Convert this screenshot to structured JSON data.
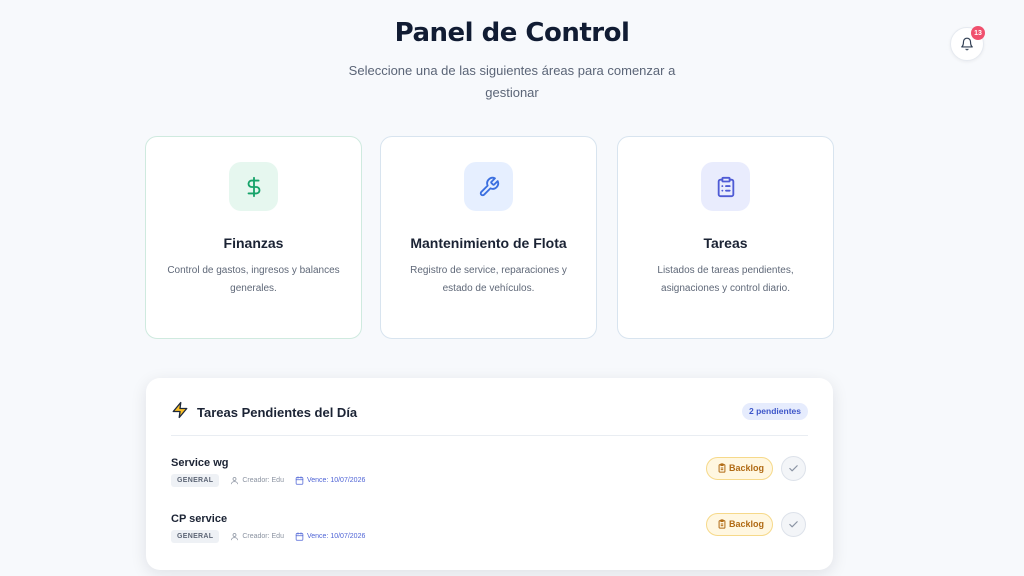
{
  "header": {
    "title": "Panel de Control",
    "subtitle": "Seleccione una de las siguientes áreas para comenzar a gestionar"
  },
  "notifications": {
    "icon": "bell-icon",
    "count": "13"
  },
  "cards": [
    {
      "icon": "dollar-icon",
      "title": "Finanzas",
      "description": "Control de gastos, ingresos y balances generales."
    },
    {
      "icon": "wrench-icon",
      "title": "Mantenimiento de Flota",
      "description": "Registro de service, reparaciones y estado de vehículos."
    },
    {
      "icon": "clipboard-icon",
      "title": "Tareas",
      "description": "Listados de tareas pendientes, asignaciones y control diario."
    }
  ],
  "pending_panel": {
    "icon": "bolt-icon",
    "title": "Tareas Pendientes del Día",
    "badge": "2 pendientes",
    "tasks": [
      {
        "name": "Service wg",
        "category": "GENERAL",
        "creator": "Creador: Edu",
        "due": "Vence: 10/07/2026",
        "status": "Backlog"
      },
      {
        "name": "CP service",
        "category": "GENERAL",
        "creator": "Creador: Edu",
        "due": "Vence: 10/07/2026",
        "status": "Backlog"
      }
    ]
  },
  "colors": {
    "accent_green": "#16a36a",
    "accent_blue": "#3b6fe0",
    "accent_indigo": "#4f5bd5",
    "badge_red": "#f0506e",
    "backlog_amber": "#b06a14"
  }
}
